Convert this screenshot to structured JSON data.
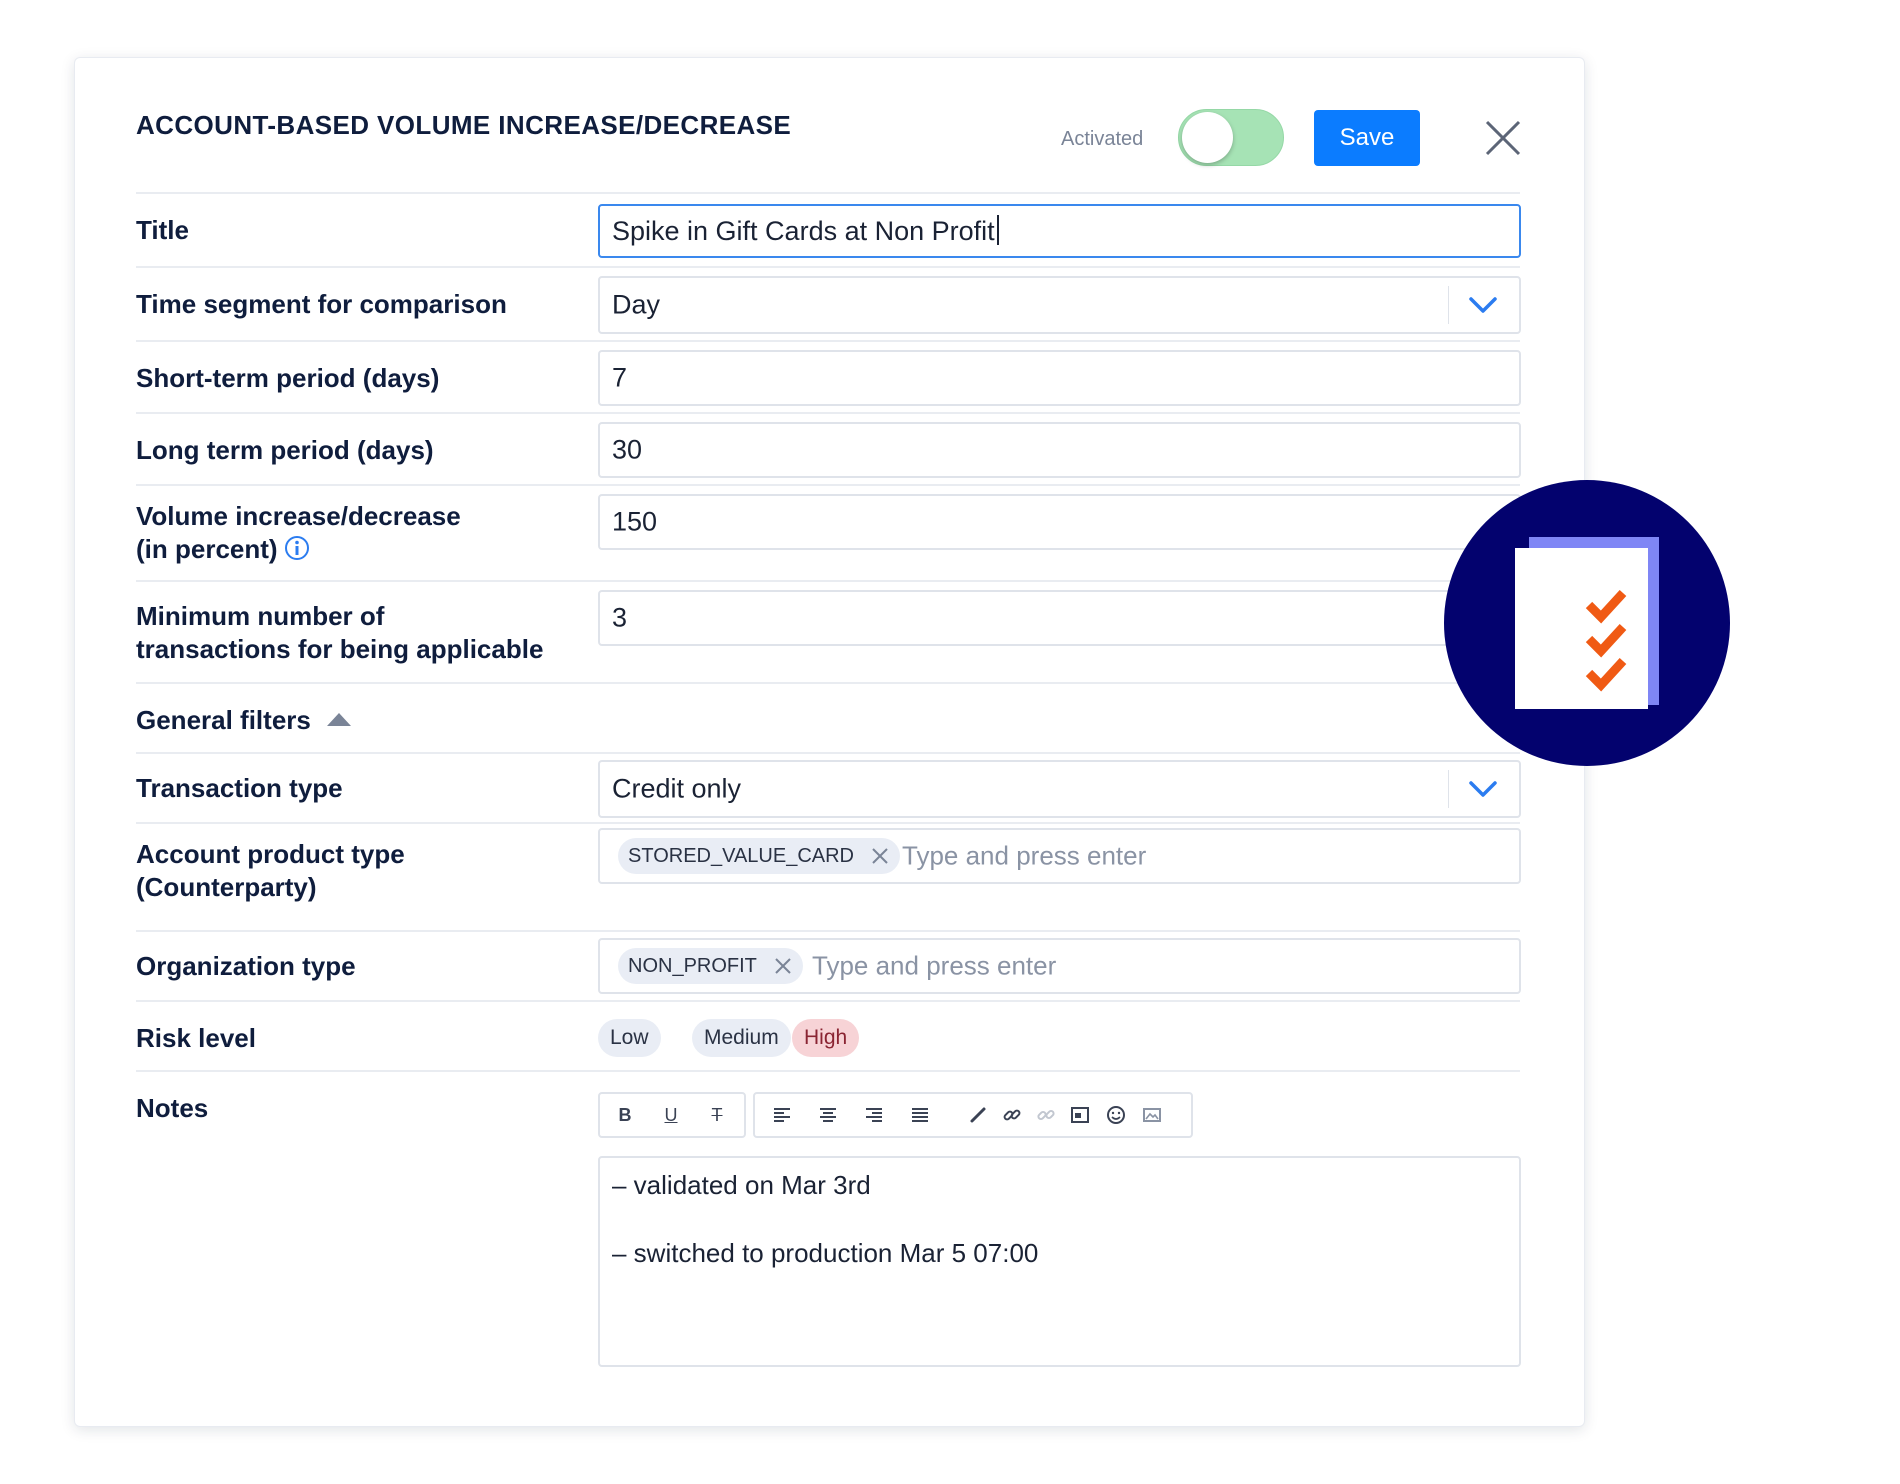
{
  "modal": {
    "title": "ACCOUNT-BASED VOLUME INCREASE/DECREASE",
    "activated_label": "Activated",
    "activated": true,
    "save_label": "Save"
  },
  "form": {
    "title": {
      "label": "Title",
      "value": "Spike in Gift Cards at Non Profit"
    },
    "time_segment": {
      "label": "Time segment for comparison",
      "value": "Day"
    },
    "short_term": {
      "label": "Short-term period (days)",
      "value": "7"
    },
    "long_term": {
      "label": "Long term period (days)",
      "value": "30"
    },
    "volume": {
      "label_line1": "Volume increase/decrease",
      "label_line2": "(in percent)",
      "value": "150"
    },
    "min_tx": {
      "label_line1": "Minimum number of",
      "label_line2": "transactions for being applicable",
      "value": "3"
    }
  },
  "general_filters": {
    "label": "General filters",
    "expanded": true,
    "transaction_type": {
      "label": "Transaction type",
      "value": "Credit only"
    },
    "account_product": {
      "label_line1": "Account product type",
      "label_line2": "(Counterparty)",
      "tags": [
        "STORED_VALUE_CARD"
      ],
      "placeholder": "Type and press enter"
    },
    "organization": {
      "label": "Organization type",
      "tags": [
        "NON_PROFIT"
      ],
      "placeholder": "Type and press enter"
    },
    "risk_level": {
      "label": "Risk level",
      "options": [
        "Low",
        "Medium",
        "High"
      ],
      "selected": "High"
    }
  },
  "notes": {
    "label": "Notes",
    "lines": [
      "– validated on Mar 3rd",
      "– switched to production Mar 5 07:00"
    ],
    "toolbar": {
      "bold": "B",
      "underline": "U",
      "strikethrough": "T"
    }
  },
  "colors": {
    "primary": "#0b7cff",
    "toggle_on": "#a6e3b5",
    "badge_bg": "#03026e",
    "check": "#f05a14",
    "risk_high_bg": "#f7d3d6"
  }
}
